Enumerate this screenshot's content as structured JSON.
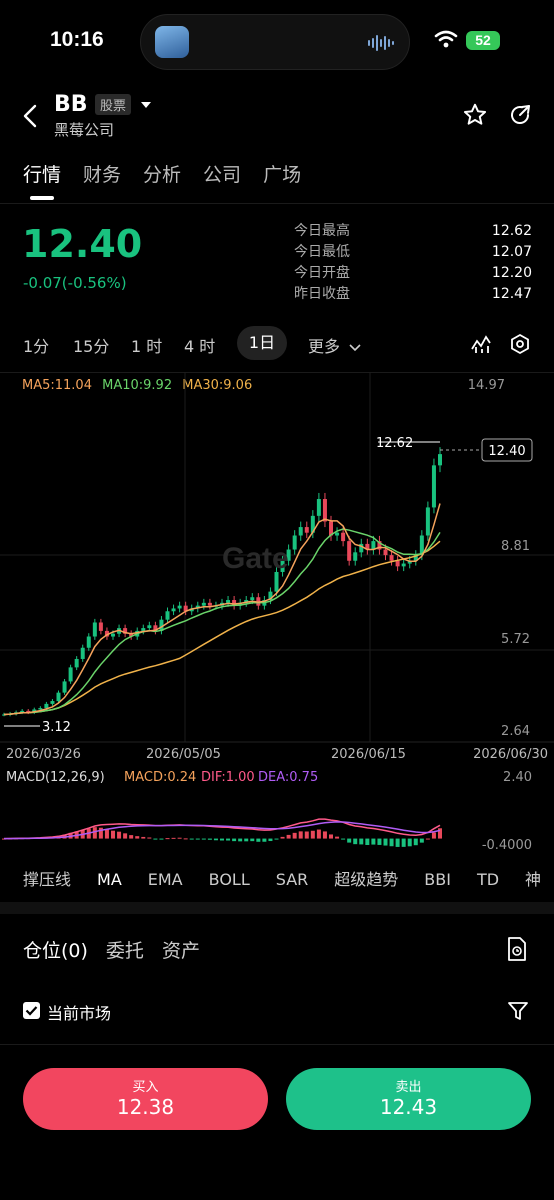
{
  "status_bar": {
    "time": "10:16",
    "battery": "52"
  },
  "header": {
    "ticker": "BB",
    "tag": "股票",
    "name": "黑莓公司"
  },
  "tabs": [
    {
      "label": "行情"
    },
    {
      "label": "财务"
    },
    {
      "label": "分析"
    },
    {
      "label": "公司"
    },
    {
      "label": "广场"
    }
  ],
  "quote": {
    "price": "12.40",
    "change": "-0.07(-0.56%)",
    "stats": [
      {
        "label": "今日最高",
        "value": "12.62"
      },
      {
        "label": "今日最低",
        "value": "12.07"
      },
      {
        "label": "今日开盘",
        "value": "12.20"
      },
      {
        "label": "昨日收盘",
        "value": "12.47"
      }
    ]
  },
  "timeframes": [
    "1分",
    "15分",
    "1 时",
    "4 时",
    "1日",
    "更多"
  ],
  "ma_legend": {
    "ma5": "MA5:11.04",
    "ma10": "MA10:9.92",
    "ma30": "MA30:9.06"
  },
  "chart_data": {
    "type": "candlestick",
    "y_ticks": [
      "14.97",
      "8.81",
      "5.72",
      "2.64"
    ],
    "x_ticks": [
      "2026/03/26",
      "2026/05/05",
      "2026/06/15",
      "2026/06/30"
    ],
    "high_label": "12.62",
    "low_label": "3.12",
    "current_price_label": "12.40",
    "ylim": [
      2.64,
      14.97
    ],
    "closes": [
      3.12,
      3.15,
      3.2,
      3.25,
      3.2,
      3.3,
      3.35,
      3.5,
      3.6,
      3.9,
      4.3,
      4.8,
      5.1,
      5.5,
      5.9,
      6.4,
      6.1,
      5.9,
      6.0,
      6.2,
      6.0,
      5.9,
      6.1,
      6.2,
      6.3,
      6.1,
      6.5,
      6.8,
      6.9,
      7.0,
      6.8,
      6.9,
      7.0,
      7.1,
      7.0,
      7.0,
      7.1,
      7.2,
      7.0,
      7.1,
      7.2,
      7.3,
      7.0,
      7.2,
      7.5,
      8.2,
      8.6,
      9.0,
      9.5,
      9.8,
      9.6,
      10.2,
      10.8,
      10.0,
      9.5,
      9.6,
      9.3,
      8.6,
      8.9,
      9.2,
      9.0,
      9.3,
      9.0,
      8.8,
      8.6,
      8.4,
      8.5,
      8.6,
      8.8,
      9.5,
      10.5,
      12.0,
      12.4
    ],
    "macd_legend": {
      "params": "MACD(12,26,9)",
      "macd": "MACD:0.24",
      "dif": "DIF:1.00",
      "dea": "DEA:0.75"
    },
    "macd_ticks": [
      "2.40",
      "-0.4000"
    ]
  },
  "indicators": [
    "撑压线",
    "MA",
    "EMA",
    "BOLL",
    "SAR",
    "超级趋势",
    "BBI",
    "TD",
    "神"
  ],
  "position_tabs": [
    "仓位(0)",
    "委托",
    "资产"
  ],
  "filter_label": "当前市场",
  "buy": {
    "label": "买入",
    "price": "12.38"
  },
  "sell": {
    "label": "卖出",
    "price": "12.43"
  },
  "colors": {
    "up": "#e8485a",
    "down": "#19c27f",
    "ma5": "#f5a35c",
    "ma10": "#6ad46a",
    "ma30": "#f0b24a",
    "dif": "#ff5a8a",
    "dea": "#b05cf5"
  }
}
